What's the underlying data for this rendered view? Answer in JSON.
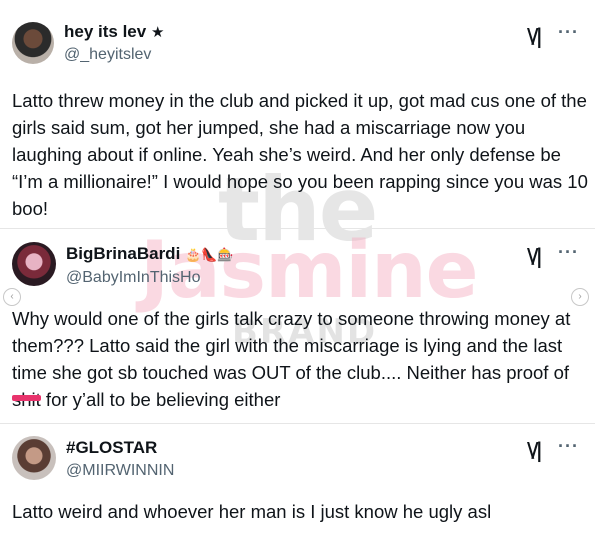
{
  "watermark": {
    "line1": "the",
    "line2": "Jasmine",
    "line3": "BRAND"
  },
  "tweets": [
    {
      "name": "hey its lev",
      "name_badge": "★",
      "handle": "@_heyitslev",
      "text": "Latto threw money in the club and picked it up, got mad cus one of the girls said sum, got her jumped, she had a miscarriage now you laughing about if online. Yeah she’s weird. And her only defense be “I’m a millionaire!” I would hope so you been rapping since you was 10 boo!"
    },
    {
      "name": "BigBrinaBardi",
      "name_emojis": "🎂👠🎰",
      "handle": "@BabyImInThisHo",
      "text_before": "Why would one of the girls talk crazy to someone throwing money at them??? Latto said the girl with the miscarriage is lying and the last time she got sb touched was OUT of the club.... Neither has proof of ",
      "censored_word": "shit",
      "text_after": " for y’all to be believing either"
    },
    {
      "name": "#GLOSTAR",
      "handle": "@MIIRWINNIN",
      "text": "Latto weird and whoever her man is I just know he ugly asl"
    }
  ],
  "icons": {
    "grok": "grok-icon",
    "more": "more-options-icon",
    "more_glyph": "···",
    "grok_glyph": "\\/|",
    "carousel_left": "‹",
    "carousel_right": "›"
  },
  "colors": {
    "watermark_gray": "#d9d9d9",
    "watermark_pink": "#f7c9d6",
    "censor": "#e8336c",
    "handle": "#536471"
  }
}
